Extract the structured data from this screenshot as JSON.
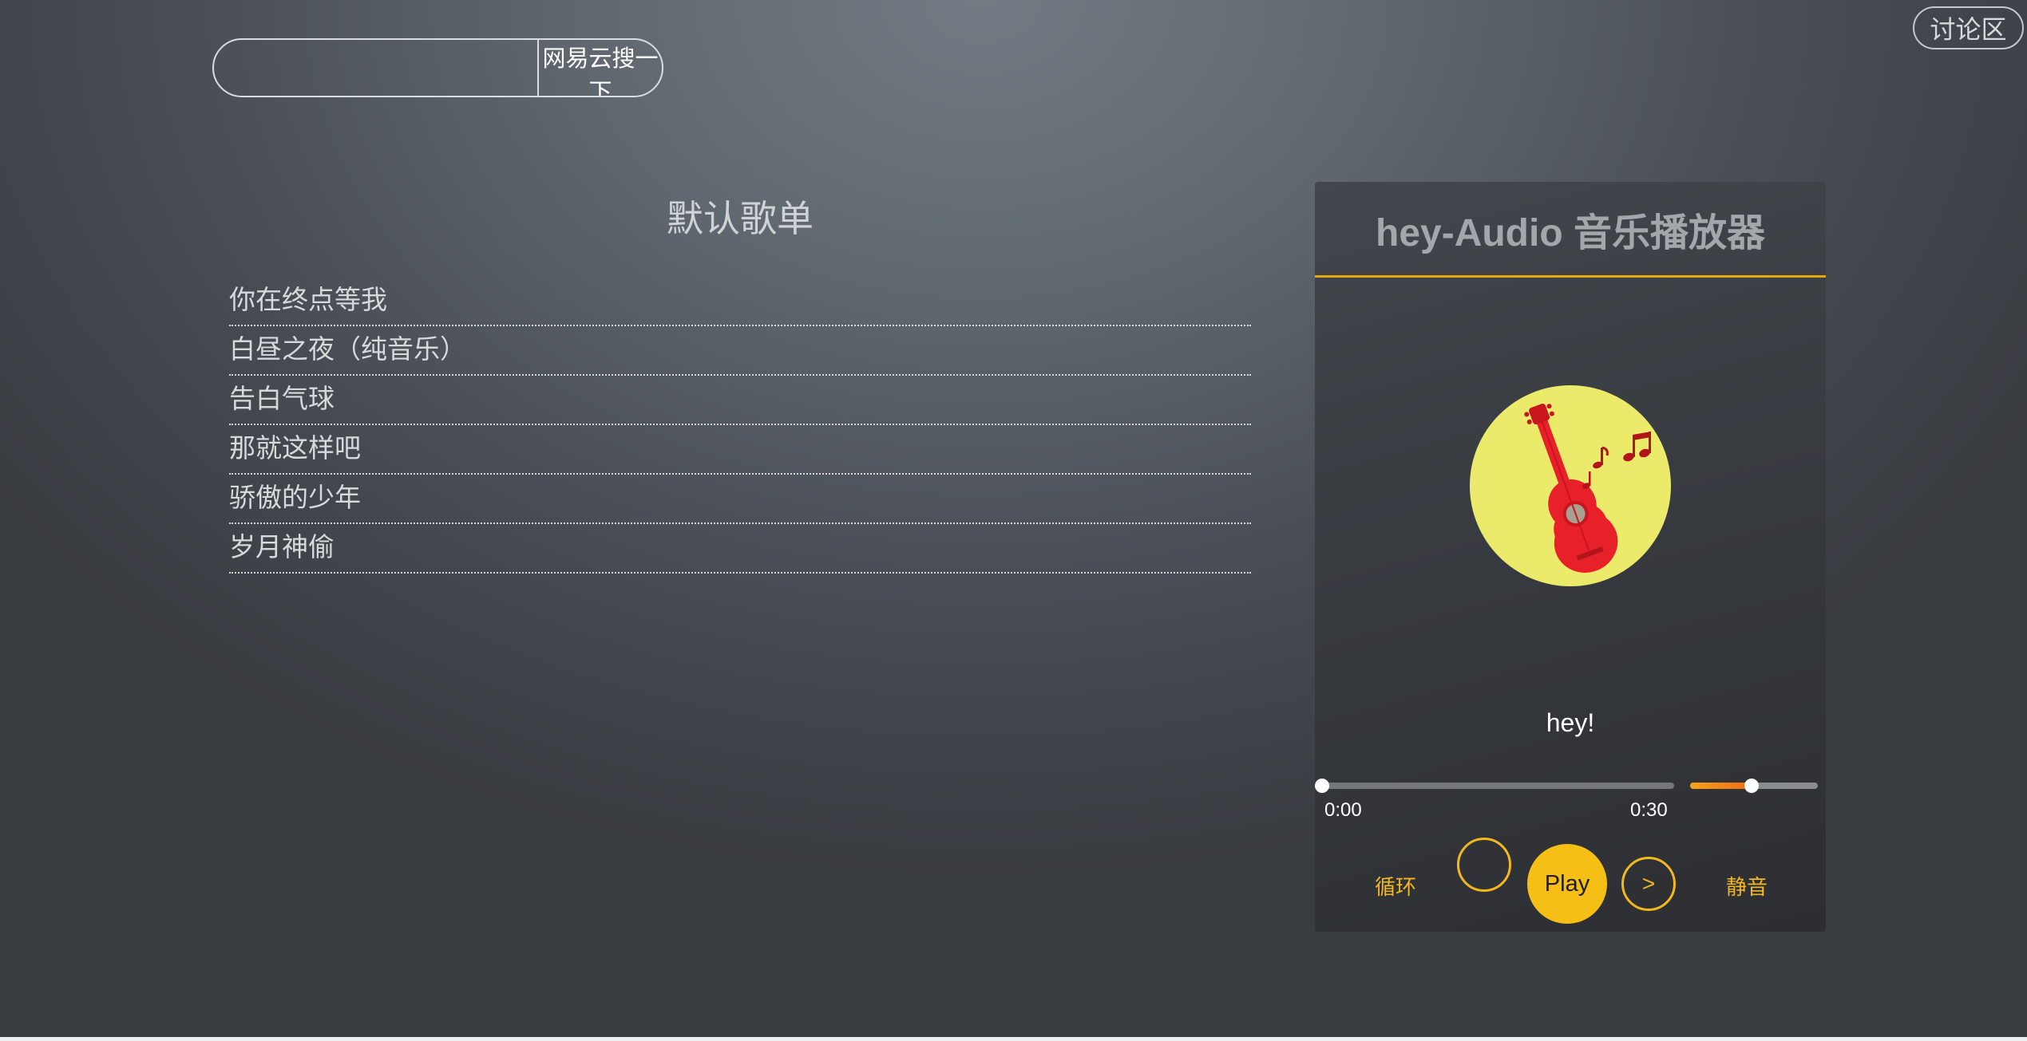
{
  "search": {
    "value": "",
    "placeholder": "",
    "button_label": "网易云搜一下"
  },
  "forum_link": "讨论区",
  "playlist": {
    "title": "默认歌单",
    "songs": [
      "你在终点等我",
      "白昼之夜（纯音乐）",
      "告白气球",
      "那就这样吧",
      "骄傲的少年",
      "岁月神偷"
    ]
  },
  "player": {
    "title": "hey-Audio 音乐播放器",
    "song_name": "hey!",
    "time_current": "0:00",
    "time_total": "0:30",
    "progress": 0.0,
    "volume": 0.48,
    "album_icon": "guitar-music-notes-icon",
    "controls": {
      "loop_label": "循环",
      "play_label": "Play",
      "next_label": ">",
      "mute_label": "静音"
    }
  },
  "colors": {
    "accent": "#f5bf15",
    "accent_text": "#f2b81e",
    "album_bg": "#ecea6b",
    "guitar": "#e8202a"
  }
}
